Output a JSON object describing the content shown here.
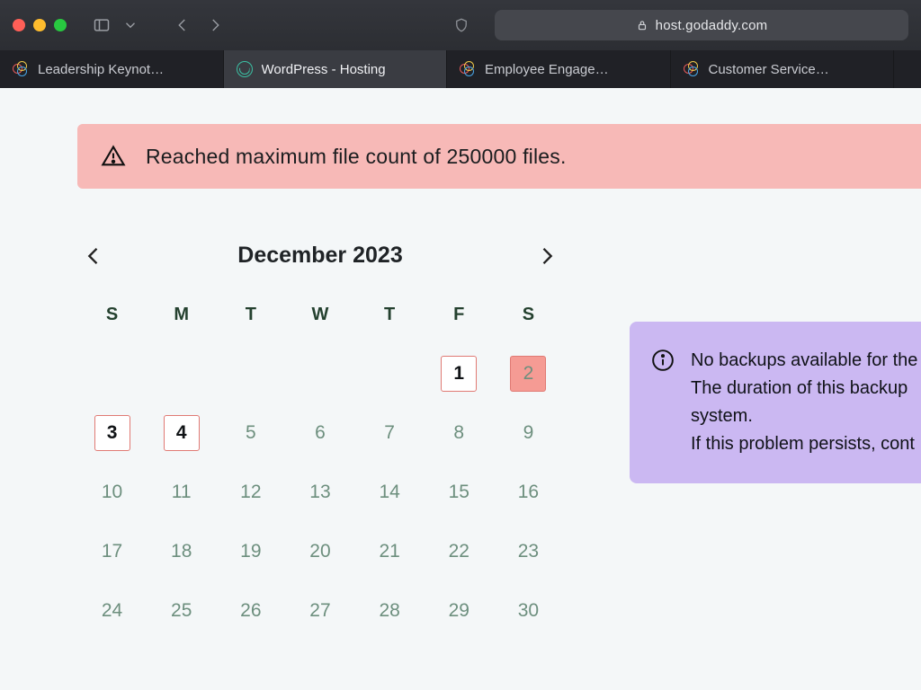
{
  "browser": {
    "url_host": "host.godaddy.com",
    "tabs": [
      {
        "label": "Leadership Keynot…",
        "active": false,
        "icon": "rings"
      },
      {
        "label": "WordPress - Hosting",
        "active": true,
        "icon": "wp"
      },
      {
        "label": "Employee Engage…",
        "active": false,
        "icon": "rings"
      },
      {
        "label": "Customer Service…",
        "active": false,
        "icon": "rings"
      }
    ]
  },
  "alert": {
    "text": "Reached maximum file count of 250000 files."
  },
  "calendar": {
    "title": "December 2023",
    "dow": [
      "S",
      "M",
      "T",
      "W",
      "T",
      "F",
      "S"
    ],
    "weeks": [
      [
        {
          "n": ""
        },
        {
          "n": ""
        },
        {
          "n": ""
        },
        {
          "n": ""
        },
        {
          "n": ""
        },
        {
          "n": "1",
          "state": "avail"
        },
        {
          "n": "2",
          "state": "selected"
        }
      ],
      [
        {
          "n": "3",
          "state": "avail"
        },
        {
          "n": "4",
          "state": "avail"
        },
        {
          "n": "5"
        },
        {
          "n": "6"
        },
        {
          "n": "7"
        },
        {
          "n": "8"
        },
        {
          "n": "9"
        }
      ],
      [
        {
          "n": "10"
        },
        {
          "n": "11"
        },
        {
          "n": "12"
        },
        {
          "n": "13"
        },
        {
          "n": "14"
        },
        {
          "n": "15"
        },
        {
          "n": "16"
        }
      ],
      [
        {
          "n": "17"
        },
        {
          "n": "18"
        },
        {
          "n": "19"
        },
        {
          "n": "20"
        },
        {
          "n": "21"
        },
        {
          "n": "22"
        },
        {
          "n": "23"
        }
      ],
      [
        {
          "n": "24"
        },
        {
          "n": "25"
        },
        {
          "n": "26"
        },
        {
          "n": "27"
        },
        {
          "n": "28"
        },
        {
          "n": "29"
        },
        {
          "n": "30"
        }
      ]
    ]
  },
  "info_panel": {
    "line1": "No backups available for the",
    "line2": "The duration of this backup",
    "line3": "system.",
    "line4": "If this problem persists, cont"
  }
}
